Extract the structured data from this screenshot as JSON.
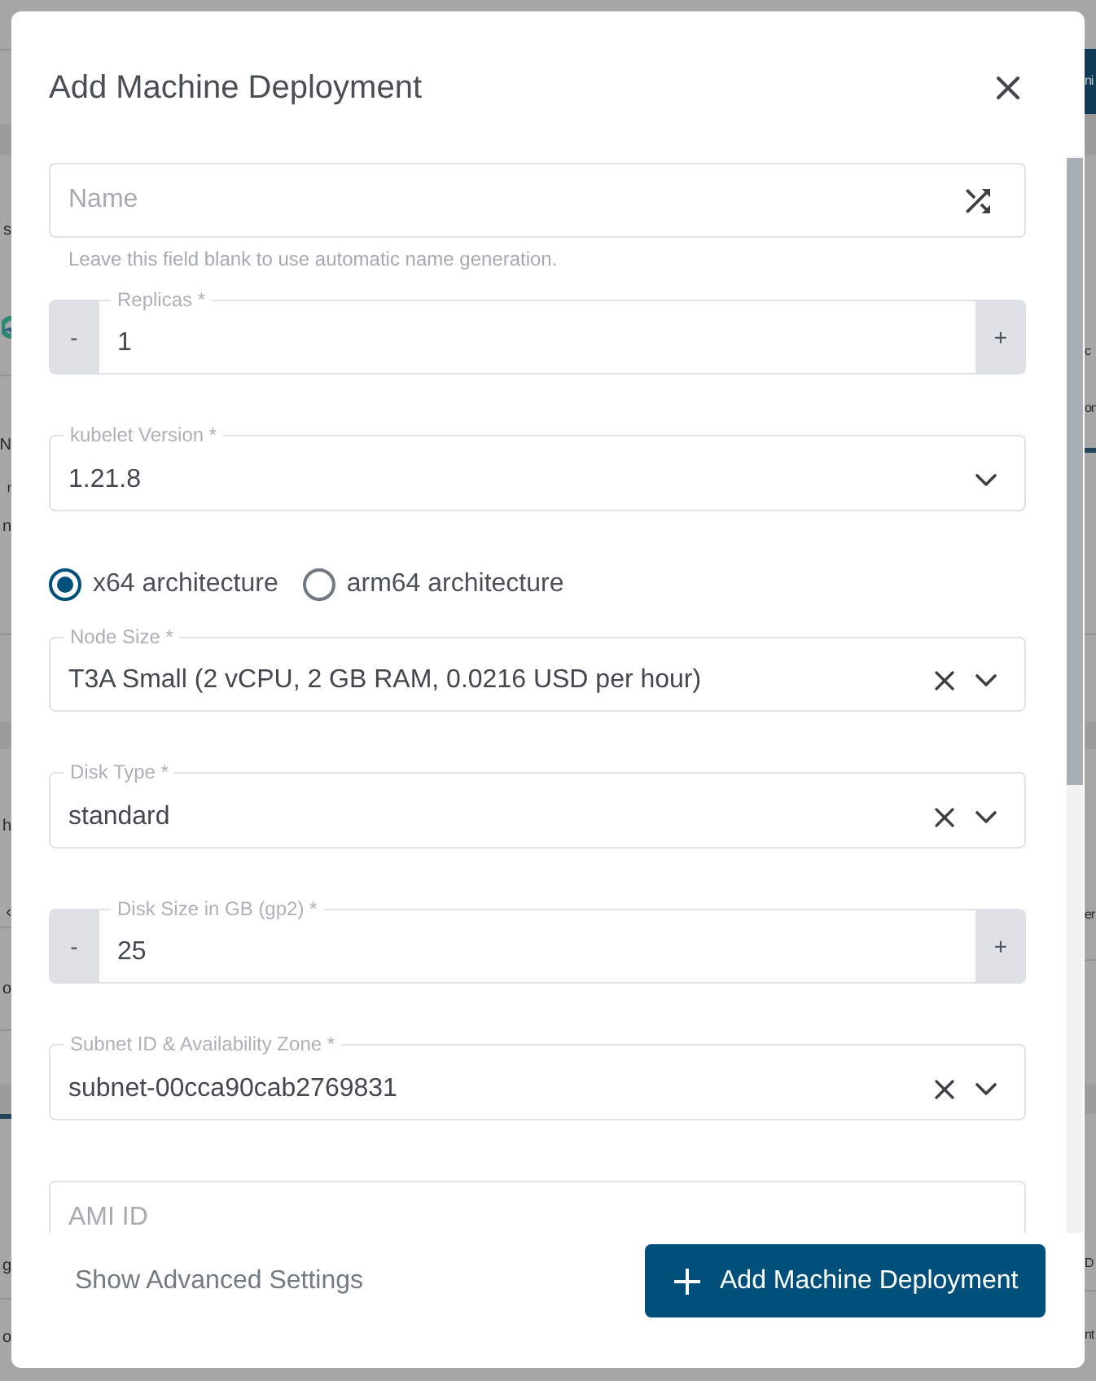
{
  "background_page": {
    "left_edge_texts": [
      "s",
      "N",
      "r",
      "n",
      "h",
      "‹",
      "o",
      "g",
      "o"
    ],
    "right_edge_texts": [
      "ni",
      "c",
      "on",
      "er",
      "D",
      "nt"
    ]
  },
  "dialog": {
    "title": "Add Machine Deployment",
    "fields": [
      {
        "kind": "text",
        "placeholder": "Name",
        "generate_button": true,
        "hint": "Leave this field blank to use automatic name generation."
      },
      {
        "kind": "stepper",
        "label": "Replicas *",
        "value": "1",
        "decrement": "-",
        "increment": "+"
      },
      {
        "kind": "select",
        "label": "kubelet Version *",
        "value": "1.21.8",
        "clear_button": false
      },
      {
        "kind": "radio-group",
        "options": [
          {
            "label": "x64 architecture",
            "selected": true
          },
          {
            "label": "arm64 architecture",
            "selected": false
          }
        ]
      },
      {
        "kind": "select",
        "label": "Node Size *",
        "value": "T3A Small (2 vCPU, 2 GB RAM, 0.0216 USD per hour)",
        "clear_button": true
      },
      {
        "kind": "select",
        "label": "Disk Type *",
        "value": "standard",
        "clear_button": true
      },
      {
        "kind": "stepper",
        "label": "Disk Size in GB (gp2) *",
        "value": "25",
        "decrement": "-",
        "increment": "+"
      },
      {
        "kind": "select",
        "label": "Subnet ID & Availability Zone *",
        "value": "subnet-00cca90cab2769831",
        "clear_button": true
      },
      {
        "kind": "text",
        "placeholder": "AMI ID",
        "generate_button": false
      }
    ],
    "footer": {
      "link": "Show Advanced Settings",
      "primary_button": "Add Machine Deployment"
    }
  }
}
